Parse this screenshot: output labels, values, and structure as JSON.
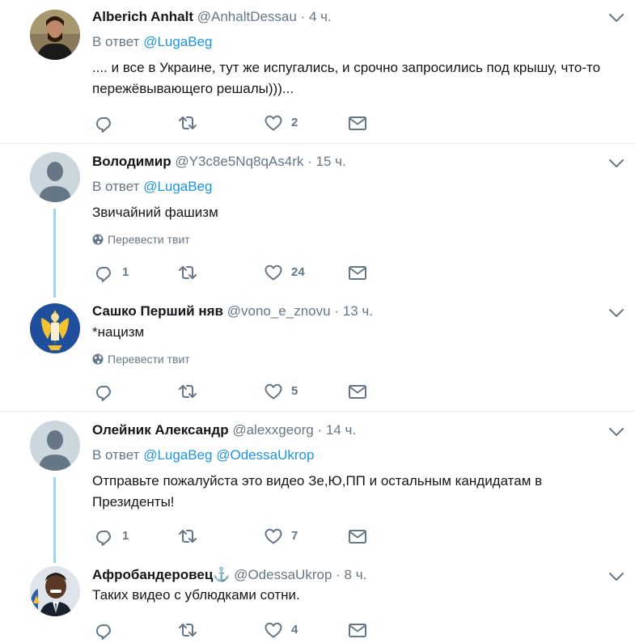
{
  "tweets": [
    {
      "name": "Alberich Anhalt",
      "handle": "@AnhaltDessau",
      "time": "4 ч.",
      "reply_prefix": "В ответ",
      "reply_to": "@LugaBeg",
      "reply_to2": "",
      "text": ".... и все в Украине, тут же испугались, и срочно запросились под крышу, что-то пережёвывающего решалы)))...",
      "translate": "",
      "replies": "",
      "retweets": "",
      "likes": "2"
    },
    {
      "name": "Володимир",
      "handle": "@Y3c8e5Nq8qAs4rk",
      "time": "15 ч.",
      "reply_prefix": "В ответ",
      "reply_to": "@LugaBeg",
      "reply_to2": "",
      "text": "Звичайний фашизм",
      "translate": "Перевести твит",
      "replies": "1",
      "retweets": "",
      "likes": "24"
    },
    {
      "name": "Сашко Перший няв",
      "handle": "@vono_e_znovu",
      "time": "13 ч.",
      "reply_prefix": "",
      "reply_to": "",
      "reply_to2": "",
      "text": "*нацизм",
      "translate": "Перевести твит",
      "replies": "",
      "retweets": "",
      "likes": "5"
    },
    {
      "name": "Олейник Александр",
      "handle": "@alexxgeorg",
      "time": "14 ч.",
      "reply_prefix": "В ответ",
      "reply_to": "@LugaBeg",
      "reply_to2": "@OdessaUkrop",
      "text": "Отправьте пожалуйста это видео Зе,Ю,ПП и остальным кандидатам в Президенты!",
      "translate": "",
      "replies": "1",
      "retweets": "",
      "likes": "7"
    },
    {
      "name": "Афробандеровец⚓",
      "handle": "@OdessaUkrop",
      "time": "8 ч.",
      "reply_prefix": "",
      "reply_to": "",
      "reply_to2": "",
      "text": "Таких видео с ублюдками сотни.",
      "translate": "",
      "replies": "",
      "retweets": "",
      "likes": "4"
    }
  ],
  "dot": "·",
  "icons": {
    "reply": "reply-icon",
    "retweet": "retweet-icon",
    "like": "heart-icon",
    "dm": "envelope-icon",
    "more": "chevron-down-icon",
    "translate": "globe-icon"
  },
  "colors": {
    "link": "#1b95e0",
    "secondary": "#657786",
    "thread": "#9fd6f5",
    "separator": "#e6ecf0"
  }
}
